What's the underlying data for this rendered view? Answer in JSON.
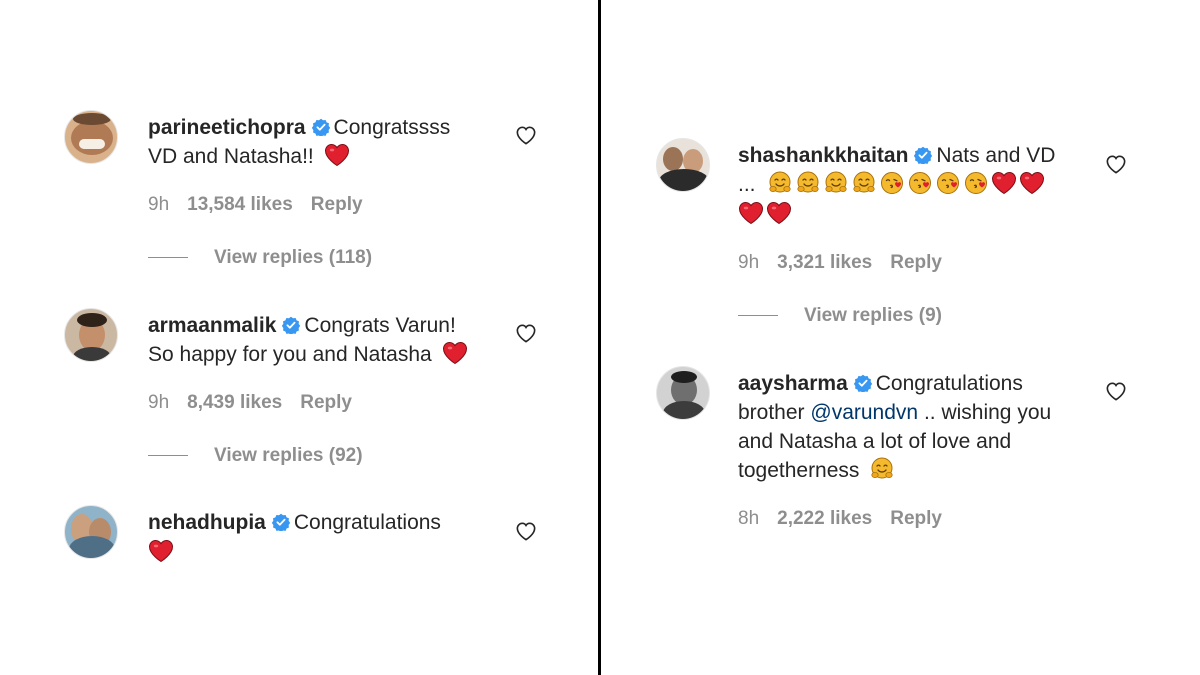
{
  "left": {
    "comments": [
      {
        "username": "parineetichopra",
        "line1": "Congratssss",
        "line2": "VD and Natasha!!",
        "time": "9h",
        "likes": "13,584 likes",
        "reply": "Reply",
        "view_replies": "View replies (118)"
      },
      {
        "username": "armaanmalik",
        "line1": "Congrats Varun!",
        "line2": "So happy for you and Natasha",
        "time": "9h",
        "likes": "8,439 likes",
        "reply": "Reply",
        "view_replies": "View replies (92)"
      },
      {
        "username": "nehadhupia",
        "line1": "Congratulations",
        "time": "",
        "likes": "",
        "reply": ""
      }
    ]
  },
  "right": {
    "comments": [
      {
        "username": "shashankkhaitan",
        "line1": "Nats and VD",
        "line2_prefix": "...",
        "time": "9h",
        "likes": "3,321 likes",
        "reply": "Reply",
        "view_replies": "View replies (9)"
      },
      {
        "username": "aaysharma",
        "line1": "Congratulations",
        "line2_prefix": "brother",
        "mention": "@varundvn",
        "line2_suffix": ".. wishing you",
        "line3": "and Natasha a lot of love and",
        "line4": "togetherness",
        "time": "8h",
        "likes": "2,222 likes",
        "reply": "Reply"
      }
    ]
  },
  "colors": {
    "username": "#262626",
    "meta": "#8e8e8e",
    "verified": "#3897f0",
    "mention": "#00376b",
    "heart_emoji": "#e0202e",
    "smile_emoji": "#f5b92e"
  },
  "icons": [
    "verified-badge-icon",
    "heart-outline-icon",
    "red-heart-emoji",
    "smiling-hug-emoji",
    "kiss-emoji"
  ]
}
